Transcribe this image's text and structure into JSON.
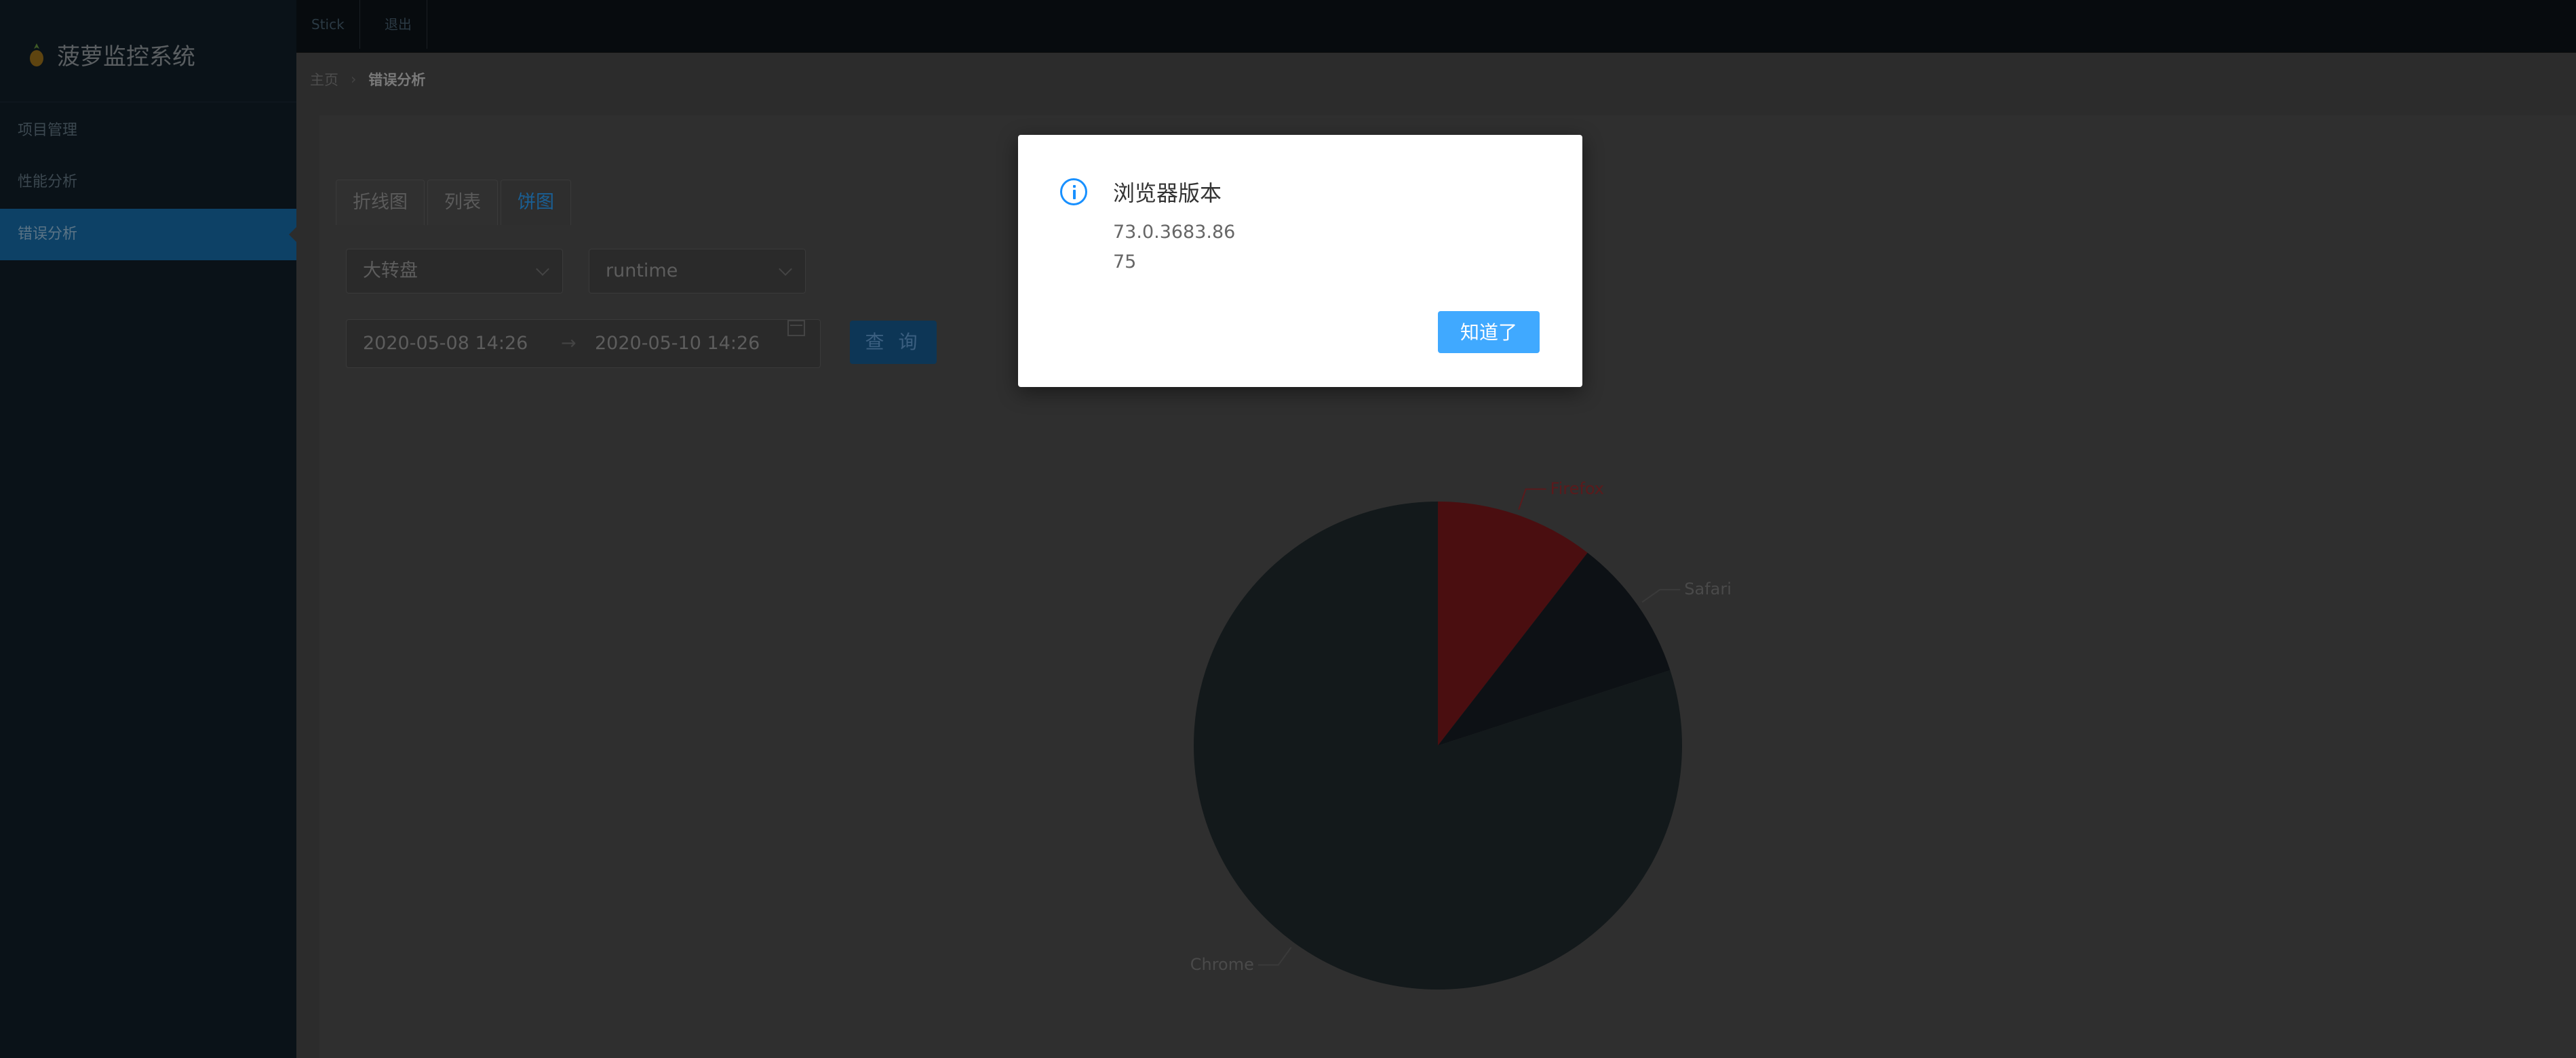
{
  "app": {
    "title": "菠萝监控系统"
  },
  "sidebar": {
    "items": [
      {
        "label": "项目管理",
        "active": false
      },
      {
        "label": "性能分析",
        "active": false
      },
      {
        "label": "错误分析",
        "active": true
      }
    ]
  },
  "topbar": {
    "links": [
      "Stick",
      "退出"
    ]
  },
  "breadcrumb": {
    "home": "主页",
    "current": "错误分析"
  },
  "tabs": [
    {
      "label": "折线图",
      "active": false
    },
    {
      "label": "列表",
      "active": false
    },
    {
      "label": "饼图",
      "active": true
    }
  ],
  "filters": {
    "project_select": "大转盘",
    "type_select": "runtime",
    "date_start": "2020-05-08 14:26",
    "date_separator": "→",
    "date_end": "2020-05-10 14:26",
    "query_button": "查 询"
  },
  "chart_data": {
    "type": "pie",
    "series": [
      {
        "name": "Firefox",
        "value": 10.5,
        "color": "#4a0e10"
      },
      {
        "name": "Safari",
        "value": 9.5,
        "color": "#0d1115"
      },
      {
        "name": "Chrome",
        "value": 80,
        "color": "#13191b"
      }
    ]
  },
  "modal": {
    "title": "浏览器版本",
    "lines": [
      "73.0.3683.86",
      "75"
    ],
    "ok_button": "知道了"
  },
  "colors": {
    "accent": "#40a9ff",
    "info_icon": "#1890ff",
    "sidebar_bg": "#0a1218"
  }
}
